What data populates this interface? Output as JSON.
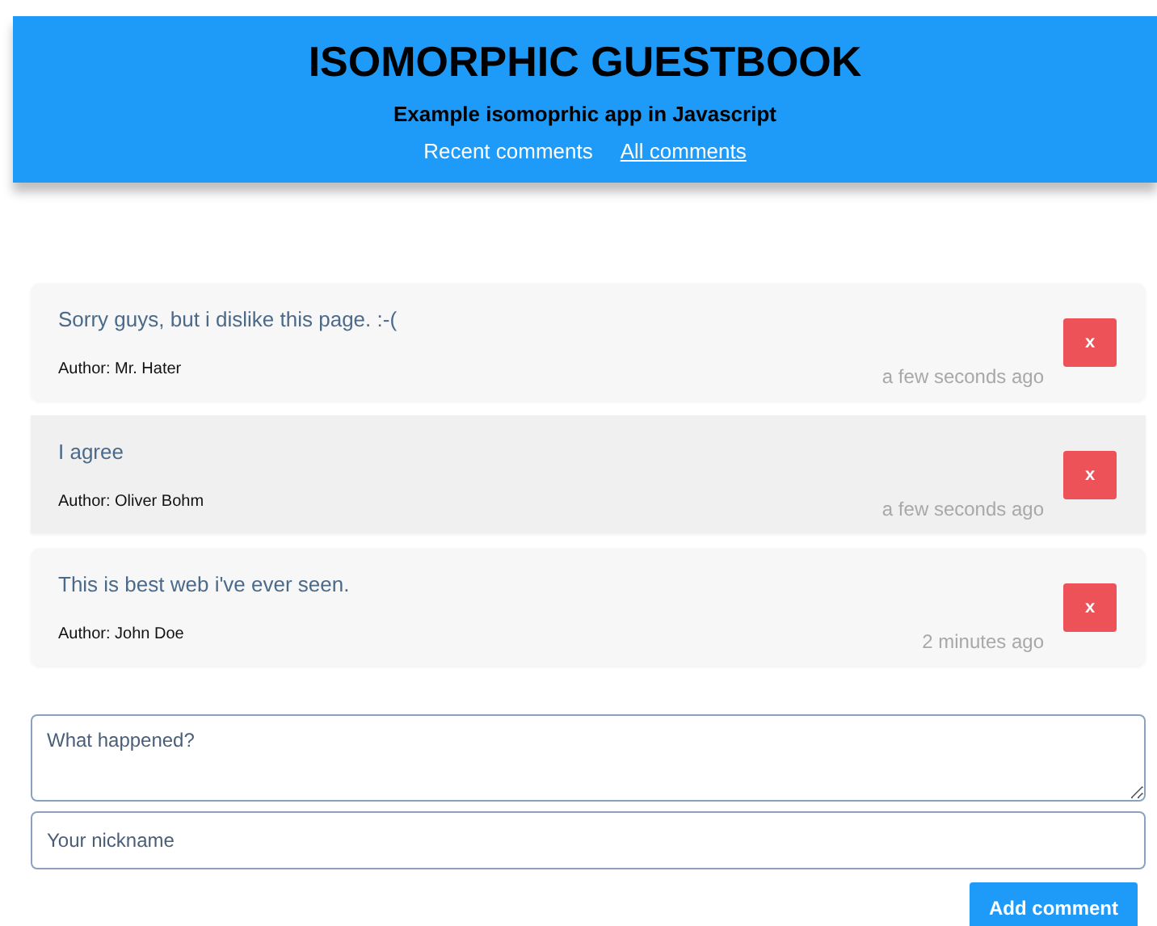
{
  "header": {
    "title": "ISOMORPHIC GUESTBOOK",
    "subtitle": "Example isomoprhic app in Javascript",
    "nav": [
      {
        "label": "Recent comments",
        "selected": false
      },
      {
        "label": "All comments",
        "selected": true
      }
    ]
  },
  "comments": [
    {
      "text": "Sorry guys, but i dislike this page. :-(",
      "author": "Author: Mr. Hater",
      "time": "a few seconds ago",
      "delete_label": "x",
      "hovered": false
    },
    {
      "text": "I agree",
      "author": "Author: Oliver Bohm",
      "time": "a few seconds ago",
      "delete_label": "x",
      "hovered": true
    },
    {
      "text": "This is best web i've ever seen.",
      "author": "Author: John Doe",
      "time": "2 minutes ago",
      "delete_label": "x",
      "hovered": false
    }
  ],
  "form": {
    "message": {
      "placeholder": "What happened?"
    },
    "nickname": {
      "placeholder": "Your nickname"
    },
    "submit": "Add comment"
  }
}
